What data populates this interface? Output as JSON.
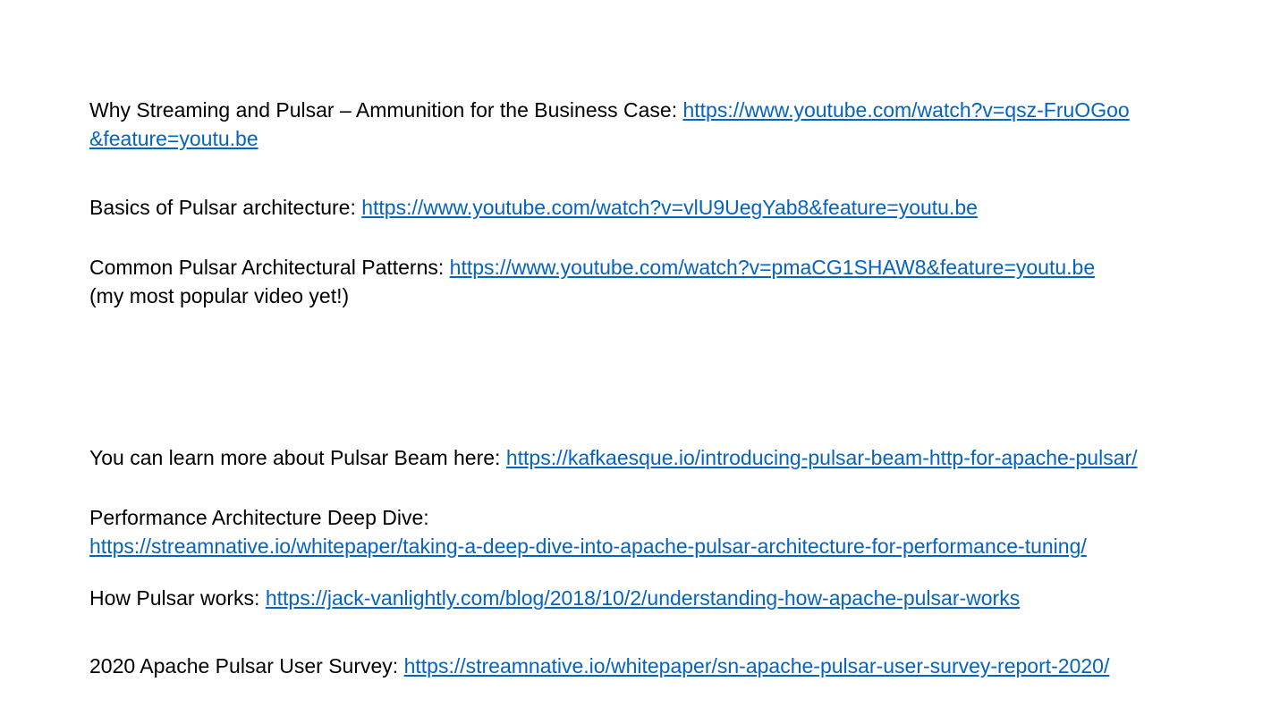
{
  "links": [
    {
      "label": "Why Streaming and Pulsar – Ammunition for the Business Case:",
      "url": "https://www.youtube.com/watch?v=qsz-FruOGoo&feature=youtu.be"
    },
    {
      "label": "Basics of Pulsar architecture:",
      "url": "https://www.youtube.com/watch?v=vlU9UegYab8&feature=youtu.be"
    },
    {
      "label": "Common Pulsar Architectural Patterns:",
      "url": "https://www.youtube.com/watch?v=pmaCG1SHAW8&feature=youtu.be",
      "note": "(my most popular video yet!)"
    },
    {
      "label": "You can learn more about Pulsar Beam here:",
      "url": "https://kafkaesque.io/introducing-pulsar-beam-http-for-apache-pulsar/"
    },
    {
      "label": "Performance Architecture Deep Dive:",
      "url": "https://streamnative.io/whitepaper/taking-a-deep-dive-into-apache-pulsar-architecture-for-performance-tuning/"
    },
    {
      "label": "How Pulsar works:",
      "url": "https://jack-vanlightly.com/blog/2018/10/2/understanding-how-apache-pulsar-works"
    },
    {
      "label": "2020 Apache Pulsar User Survey:",
      "url": "https://streamnative.io/whitepaper/sn-apache-pulsar-user-survey-report-2020/"
    }
  ],
  "colors": {
    "text": "#000000",
    "link": "#0563c1",
    "background": "#ffffff"
  }
}
